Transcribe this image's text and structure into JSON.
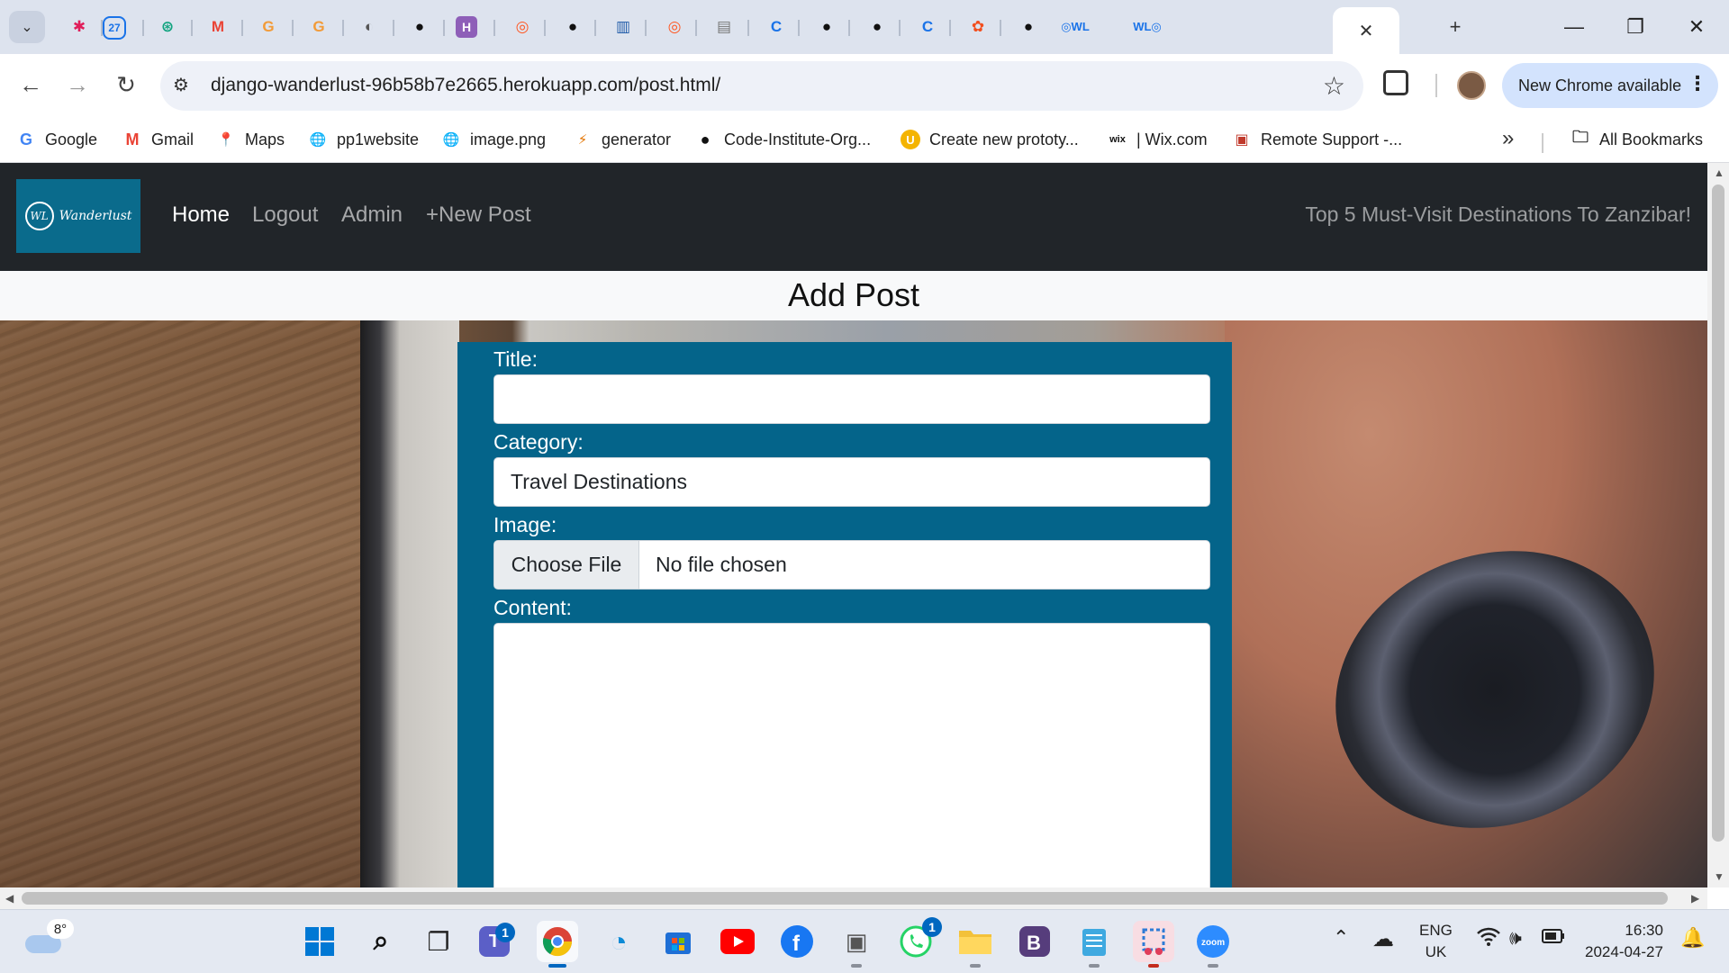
{
  "browser": {
    "tabs": {
      "active_close_glyph": "✕",
      "new_tab_glyph": "+"
    },
    "window_controls": {
      "minimize": "—",
      "restore": "❐",
      "close": "✕"
    },
    "nav": {
      "back": "←",
      "forward": "→",
      "reload": "↻"
    },
    "address_bar": {
      "url": "django-wanderlust-96b58b7e2665.herokuapp.com/post.html/"
    },
    "update_button": {
      "label": "New Chrome available"
    },
    "bookmarks": [
      {
        "label": "Google",
        "icon": "google-icon",
        "glyph": "G",
        "color": "#4285f4"
      },
      {
        "label": "Gmail",
        "icon": "gmail-icon",
        "glyph": "M",
        "color": "#ea4335"
      },
      {
        "label": "Maps",
        "icon": "maps-icon",
        "glyph": "📍",
        "color": "#34a853"
      },
      {
        "label": "pp1website",
        "icon": "globe-icon",
        "glyph": "🌐",
        "color": "#555555"
      },
      {
        "label": "image.png",
        "icon": "globe-icon",
        "glyph": "🌐",
        "color": "#555555"
      },
      {
        "label": "generator",
        "icon": "generator-icon",
        "glyph": "⚡",
        "color": "#e37400"
      },
      {
        "label": "Code-Institute-Org...",
        "icon": "github-icon",
        "glyph": "●",
        "color": "#111111"
      },
      {
        "label": "Create new prototy...",
        "icon": "uizard-icon",
        "glyph": "U",
        "color": "#f4b400"
      },
      {
        "label": "| Wix.com",
        "icon": "wix-icon",
        "glyph": "wix",
        "color": "#111111"
      },
      {
        "label": "Remote Support -...",
        "icon": "remote-support-icon",
        "glyph": "▣",
        "color": "#c0392b"
      }
    ],
    "all_bookmarks": "All Bookmarks",
    "more_glyph": "»"
  },
  "site": {
    "brand": {
      "monogram": "WL",
      "name": "Wanderlust"
    },
    "nav_links": [
      {
        "label": "Home",
        "active": true
      },
      {
        "label": "Logout",
        "active": false
      },
      {
        "label": "Admin",
        "active": false
      },
      {
        "label": "New Post",
        "active": false,
        "glyph": "+"
      }
    ],
    "featured_link": "Top 5 Must-Visit Destinations To Zanzibar!",
    "page_title": "Add Post",
    "form": {
      "title_label": "Title:",
      "title_value": "",
      "category_label": "Category:",
      "category_value": "Travel Destinations",
      "image_label": "Image:",
      "file_button": "Choose File",
      "file_status": "No file chosen",
      "content_label": "Content:",
      "content_value": ""
    },
    "colors": {
      "navbar": "#212529",
      "brand": "#0a6b8c",
      "form_panel": "#04648a"
    }
  },
  "taskbar": {
    "weather_temp": "8°",
    "teams_badge": "1",
    "whatsapp_badge": "1",
    "language": {
      "line1": "ENG",
      "line2": "UK"
    },
    "clock": {
      "time": "16:30",
      "date": "2024-04-27"
    }
  }
}
